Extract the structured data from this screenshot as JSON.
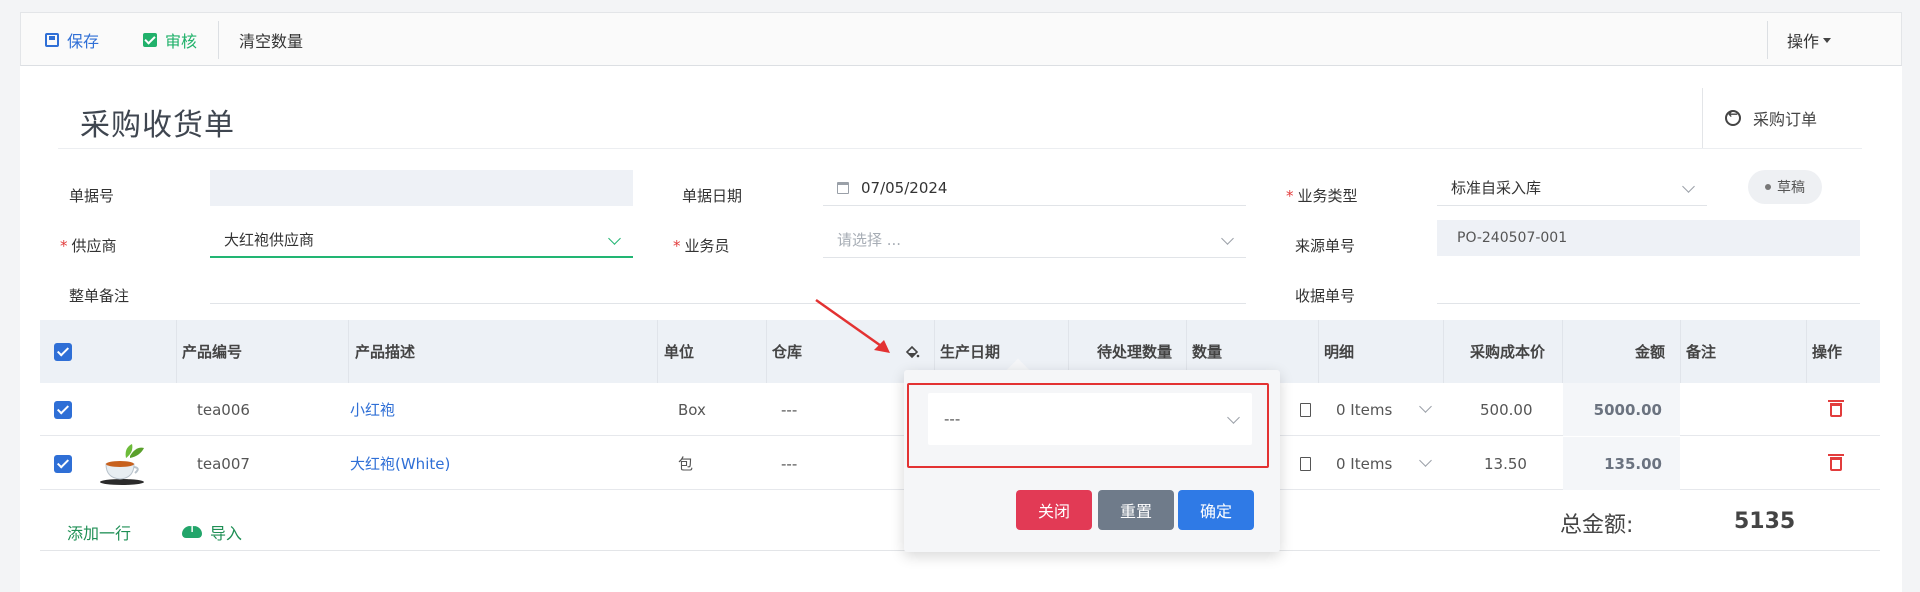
{
  "toolbar": {
    "save": "保存",
    "approve": "审核",
    "clear_qty": "清空数量",
    "actions": "操作"
  },
  "header": {
    "title": "采购收货单",
    "po_link": "采购订单",
    "status_badge": "草稿"
  },
  "form": {
    "doc_no_label": "单据号",
    "doc_no_value": "",
    "doc_date_label": "单据日期",
    "doc_date_value": "07/05/2024",
    "biz_type_label": "业务类型",
    "biz_type_value": "标准自采入库",
    "supplier_label": "供应商",
    "supplier_value": "大红袍供应商",
    "salesman_label": "业务员",
    "salesman_placeholder": "请选择 ...",
    "source_no_label": "来源单号",
    "source_no_value": "PO-240507-001",
    "remark_label": "整单备注",
    "remark_value": "",
    "receipt_no_label": "收据单号",
    "receipt_no_value": ""
  },
  "table": {
    "columns": [
      "产品编号",
      "产品描述",
      "单位",
      "仓库",
      "生产日期",
      "待处理数量",
      "数量",
      "明细",
      "采购成本价",
      "金额",
      "备注",
      "操作"
    ],
    "rows": [
      {
        "code": "tea006",
        "desc": "小红袍",
        "unit": "Box",
        "warehouse": "---",
        "detail": "0 Items",
        "price": "500.00",
        "amount": "5000.00"
      },
      {
        "code": "tea007",
        "desc": "大红袍(White)",
        "unit": "包",
        "warehouse": "---",
        "detail": "0 Items",
        "price": "13.50",
        "amount": "135.00"
      }
    ]
  },
  "footer": {
    "add_row": "添加一行",
    "import": "导入",
    "total_label": "总金额:",
    "total_value": "5135"
  },
  "popover": {
    "select_value": "---",
    "close": "关闭",
    "reset": "重置",
    "confirm": "确定"
  },
  "colors": {
    "primary": "#2f6fd6",
    "success": "#21b16b",
    "danger": "#e23c3c",
    "btn_close": "#e23a55",
    "btn_reset": "#6f7b8a",
    "btn_confirm": "#2f7ae6"
  }
}
